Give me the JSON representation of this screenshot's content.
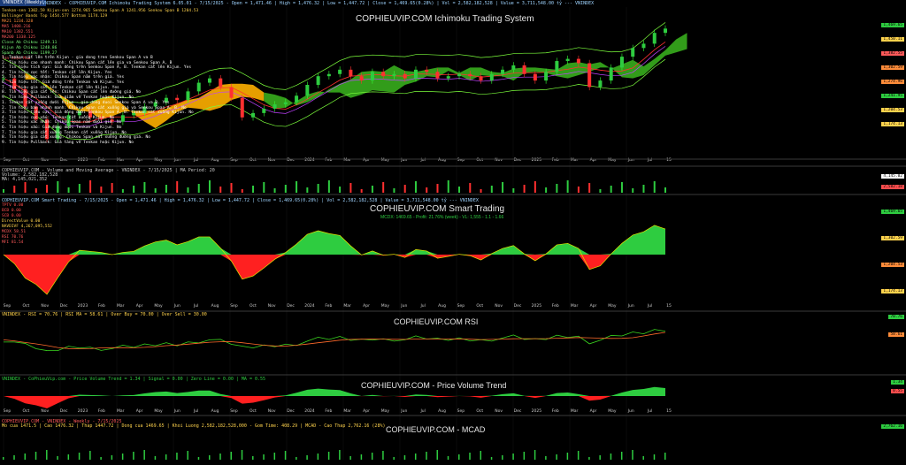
{
  "window": {
    "tab_label": "VNINDEX (Weekly)",
    "top_header": "VNINDEX - COPHIEUVIP.COM Ichimoku Trading System 6.05.01 - 7/15/2025 - Open = 1,471.46 | High = 1,476.32 | Low = 1,447.72 | Close = 1,469.65(0.28%) | Vol = 2,582,182,528 | Value = 3,711,548.00 tỷ --- VNINDEX"
  },
  "panels": {
    "ichimoku": {
      "title": "COPHIEUVIP.COM Ichimoku Trading System",
      "indicators": [
        {
          "text": "Tenkan-sen 1302.59  Kijun-sen 1274.965  Senkou Span A 1241.956  Senkou Span B 1204.53",
          "color": "#ffd34d"
        },
        {
          "text": "Bollinger Bands Top 1454.577  Bottom 1174.129",
          "color": "#ffd34d"
        },
        {
          "text": "MA21 1234.328",
          "color": "#ff8c3a"
        },
        {
          "text": "MA5 1408.216",
          "color": "#ff5a5a"
        },
        {
          "text": "MA10 1382.551",
          "color": "#ff5a5a"
        },
        {
          "text": "MA200 1338.125",
          "color": "#ff5a5a"
        },
        {
          "text": "Close Ab Chikou 1249.11",
          "color": "#7cff7c"
        },
        {
          "text": "Kijun Ab Chikou 1248.86",
          "color": "#7cff7c"
        },
        {
          "text": "Spanb Ab Chikou 1199.27",
          "color": "#7cff7c"
        },
        {
          "text": "Tín hiệu Mua",
          "color": "#ff4d4d"
        }
      ],
      "notes_buy": [
        "1. Tenkan cắt lên trên Kijun - gia dong tren Senkou Span A va B",
        "2. Tín hiệu cao nhanh manh: Chikou Span cắt lên gia va Senkou Span A, B",
        "3. Tín hiệu tích cực: Giá đóng trên Senkou Span A, B. Tenkan cắt lên Kijun. Yes",
        "4. Tín hiệu cực tốt: Tenkan cắt lên Kijun. Yes",
        "5. Tín hiệu xác nhận: Chikou Span nằm trên giá. Yes",
        "6. Tín hiệu tốt: Giá đóng trên Tenkan và Kijun. Yes",
        "7. Tín hiệu gia cắt lên Tenkan cắt lên Kijun. Yes",
        "8. Tín hiệu gia cắt lên: Chikou Span cắt lên đường giá. No",
        "9. Tín hiệu Pullback: Giá giảm về Tenkan hoặc Kijun. No"
      ],
      "notes_sell": [
        "1. Tenkan cắt xuống dưới Kijun - gia dong duoi Senkou Span A va B. Yes",
        "2. Tín hiệu bán nhanh manh: Chikou Span cắt xuống giá và Senkou Span A, B. No",
        "3. Tín hiệu tiêu cực: Giá đóng dưới Senkou Span A, B. Tenkan cắt xuống Kijun. No",
        "4. Tín hiệu cực xấu: Tenkan cắt xuống Kijun. No",
        "5. Tín hiệu xác nhận: Chikou Span nằm dưới giá. No",
        "6. Tín hiệu xấu: Giá đóng dưới Tenkan và Kijun. No",
        "7. Tín hiệu gia cắt xuống Tenkan cắt xuống Kijun. No",
        "8. Tín hiệu gia cắt xuống: Chikou Span cắt xuống đường giá. No",
        "9. Tín hiệu Pullback: Giá tăng về Tenkan hoặc Kijun. No"
      ],
      "price_tags": [
        {
          "text": "1,469.65",
          "color": "#2ecc40"
        },
        {
          "text": "1,450.11",
          "color": "#ffd34d"
        },
        {
          "text": "1,382.55",
          "color": "#ff5a5a"
        },
        {
          "text": "1,302.59",
          "color": "#ff8c3a"
        },
        {
          "text": "1,274.96",
          "color": "#ff8c3a"
        },
        {
          "text": "1,241.95",
          "color": "#2ecc40"
        },
        {
          "text": "1,204.53",
          "color": "#ffd34d"
        },
        {
          "text": "1,174.13",
          "color": "#ffd34d"
        }
      ]
    },
    "volume": {
      "header": "COPHIEUVIP.COM - Volume and Moving Average - VNINDEX - 7/15/2025 | MA Period: 20",
      "line2": "Volume: 2,582,182,528",
      "line3": "MA: 4,145,021,352",
      "tags": [
        {
          "text": "4,145.02",
          "color": "#ffffff"
        },
        {
          "text": "2,582.18",
          "color": "#ff4d4d"
        }
      ]
    },
    "smart": {
      "title": "COPHIEUVIP.COM Smart Trading",
      "subtitle": "MCDX: 1469.65 - Profit: 21.76% (week) - VL: 1,555 - 1.1 - 1.66",
      "header": "COPHIEUVIP.COM Smart Trading - 7/15/2025 - Open = 1,471.46 | High = 1,476.32 | Low = 1,447.72 | Close = 1,469.65(0.28%) | Vol = 2,582,182,528 | Value = 3,711,548.00 tỷ --- VNINDEX",
      "indicators": [
        {
          "text": "TPTV    0.00",
          "color": "#ff4d4d"
        },
        {
          "text": "BCB     0.00",
          "color": "#ff4d4d"
        },
        {
          "text": "SCB     0.00",
          "color": "#ff4d4d"
        },
        {
          "text": "DirectValue  0.00",
          "color": "#ffd34d"
        },
        {
          "text": "NAVDIVF 4,267,095,552",
          "color": "#ffd34d"
        },
        {
          "text": "MCDX    58.51",
          "color": "#ff5a5a"
        },
        {
          "text": "RSI     70.76",
          "color": "#ff5a5a"
        },
        {
          "text": "MFI     81.54",
          "color": "#ff5a5a"
        }
      ],
      "tags": [
        {
          "text": "1,469.65",
          "color": "#2ecc40"
        },
        {
          "text": "1,302.59",
          "color": "#ffd34d"
        },
        {
          "text": "1,204.53",
          "color": "#ff8c3a"
        },
        {
          "text": "1,174.13",
          "color": "#ffd34d"
        }
      ]
    },
    "rsi": {
      "title": "COPHIEUVIP.COM RSI",
      "header": "VNINDEX - RSI = 70.76 | RSI MA = 58.61 | Over Buy = 70.00 | Over Sell = 30.00",
      "tags": [
        {
          "text": "70.76",
          "color": "#2ecc40"
        },
        {
          "text": "58.61",
          "color": "#ff8c3a"
        }
      ]
    },
    "pvt": {
      "title": "COPHIEUVIP.COM - Price Volume Trend",
      "header": "VNINDEX - CoPhieuVip.com - Price Volume Trend = 1.34 | Signal = 0.00 | Zero Line = 0.00 | MA = 0.55",
      "tags": [
        {
          "text": "1.34",
          "color": "#2ecc40"
        },
        {
          "text": "0.55",
          "color": "#ff4d4d"
        }
      ]
    },
    "mcad": {
      "title": "COPHIEUVIP.COM - MCAD",
      "header1": "COPHIEUVIP.COM - VNINDEX - Weekly - 7/15/2025",
      "header2": "Mo cua 1471.5 | Cao 1476.32 | Thap 1447.72 | Dong cua 1469.65 | Khoi Luong 2,582,182,528,000 - Gom Time: 408.29 | MCAD - Cao Thap 2,762.16 (28%)",
      "tags": [
        {
          "text": "2,762.16",
          "color": "#2ecc40"
        }
      ]
    }
  },
  "time_axis": {
    "labels": [
      "Sep",
      "Oct",
      "Nov",
      "Dec",
      "2023",
      "Feb",
      "Mar",
      "Apr",
      "May",
      "Jun",
      "Jul",
      "Aug",
      "Sep",
      "Oct",
      "Nov",
      "Dec",
      "2024",
      "Feb",
      "Mar",
      "Apr",
      "May",
      "Jun",
      "Jul",
      "Aug",
      "Sep",
      "Oct",
      "Nov",
      "Dec",
      "2025",
      "Feb",
      "Mar",
      "Apr",
      "May",
      "Jun",
      "Jul",
      "15"
    ]
  },
  "chart_data": {
    "type": "candlestick",
    "title": "COPHIEUVIP.COM Ichimoku Trading System",
    "x_range": [
      "2022-09",
      "2025-07-15"
    ],
    "close_series": [
      1240,
      1190,
      1110,
      1050,
      960,
      1020,
      1070,
      1090,
      1060,
      1050,
      1040,
      1070,
      1080,
      1110,
      1130,
      1150,
      1140,
      1180,
      1220,
      1240,
      1200,
      1150,
      1060,
      1080,
      1100,
      1120,
      1130,
      1160,
      1210,
      1250,
      1260,
      1280,
      1250,
      1230,
      1270,
      1250,
      1260,
      1240,
      1280,
      1270,
      1240,
      1250,
      1260,
      1250,
      1230,
      1260,
      1280,
      1300,
      1260,
      1230,
      1270,
      1320,
      1330,
      1310,
      1200,
      1230,
      1290,
      1340,
      1380,
      1400,
      1450,
      1469.65
    ],
    "ichimoku": {
      "tenkan": 1302.59,
      "kijun": 1274.965,
      "senkou_a": 1241.956,
      "senkou_b": 1204.53
    },
    "bollinger": {
      "top": 1454.577,
      "bottom": 1174.129
    },
    "last": {
      "open": 1471.46,
      "high": 1476.32,
      "low": 1447.72,
      "close": 1469.65,
      "volume": 2582182528
    }
  }
}
